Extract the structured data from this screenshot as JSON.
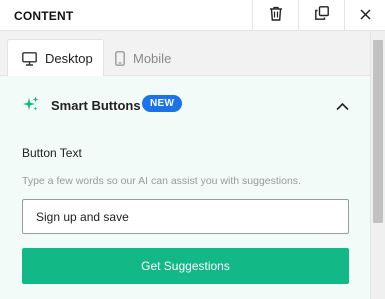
{
  "header": {
    "title": "CONTENT",
    "icons": [
      "trash-icon",
      "duplicate-icon",
      "close-icon"
    ]
  },
  "tabs": [
    {
      "label": "Desktop",
      "icon": "desktop-icon",
      "active": true
    },
    {
      "label": "Mobile",
      "icon": "mobile-icon",
      "active": false
    }
  ],
  "section": {
    "icon": "sparkle-icon",
    "title": "Smart Buttons",
    "badge": "NEW",
    "expanded": true
  },
  "form": {
    "label": "Button Text",
    "hint": "Type a few words so our AI can assist you with suggestions.",
    "input_value": "Sign up and save",
    "button_label": "Get Suggestions"
  },
  "colors": {
    "accent_green": "#12b886",
    "badge_blue": "#1a73e8",
    "panel_bg": "#f3fbf8"
  }
}
